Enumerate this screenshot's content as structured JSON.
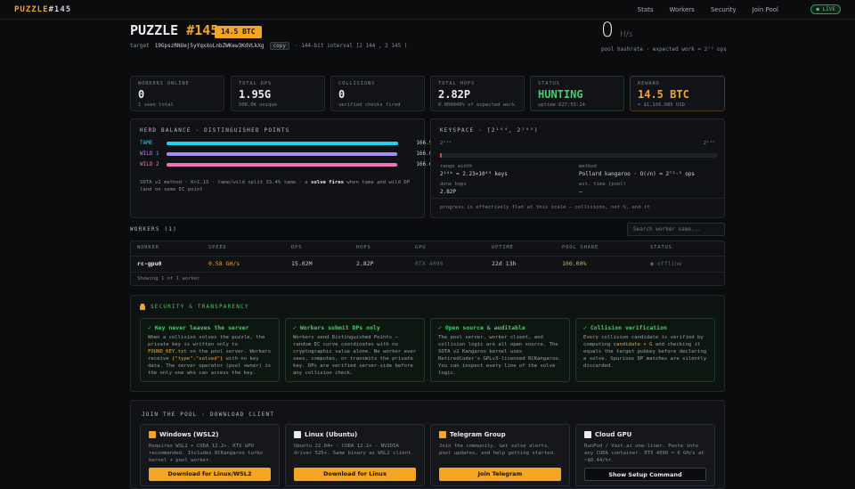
{
  "nav": {
    "brand_a": "PUZZLE",
    "brand_b": "#145",
    "links": [
      "Stats",
      "Workers",
      "Security",
      "Join Pool"
    ],
    "live": "● LIVE"
  },
  "header": {
    "title_a": "PUZZLE",
    "title_b": "#145",
    "badge": "14.5 BTC",
    "target_label": "target",
    "target_addr": "19GpszRNUej5yYqxXoLnbZWKew3KdVLkXg",
    "copy": "copy",
    "interval": "·  144-bit interval [2 144 , 2 145 )",
    "hashrate_value": "0",
    "hashrate_unit": "H/s",
    "hashrate_sub": "pool hashrate · expected work ≈ 2⁷² ops"
  },
  "stats": [
    {
      "label": "WORKERS ONLINE",
      "value": "0",
      "sub": "1 seen total",
      "color": "#e9ebee"
    },
    {
      "label": "TOTAL DPS",
      "value": "1.95G",
      "sub": "508.0K unique",
      "color": "#e9ebee"
    },
    {
      "label": "COLLISIONS",
      "value": "0",
      "sub": "verified checks fired",
      "color": "#e9ebee"
    },
    {
      "label": "TOTAL HOPS",
      "value": "2.82P",
      "sub": "0.000049% of expected work",
      "color": "#e9ebee"
    },
    {
      "label": "STATUS",
      "value": "HUNTING",
      "sub": "uptime 627:55:24",
      "color": "#3fd16b"
    },
    {
      "label": "REWARD",
      "value": "14.5 BTC",
      "sub": "≈ $1,156,085 USD",
      "color": "#f5a524"
    }
  ],
  "herd": {
    "title": "HERD BALANCE · DISTINGUISHED POINTS",
    "rows": [
      {
        "name": "TAME",
        "value": "166.9K",
        "fill": 1.0,
        "color": "#22d3ee"
      },
      {
        "name": "WILD 1",
        "value": "166.6K",
        "fill": 0.998,
        "color": "#a78bfa"
      },
      {
        "name": "WILD 2",
        "value": "166.6K",
        "fill": 0.998,
        "color": "#f472b6"
      }
    ],
    "note_a": "SOTA v2 method · K≈1.15 · tame/wild split 33.4% tame · a",
    "note_b": "solve fires",
    "note_c": "when tame and wild DP land on same EC point"
  },
  "keyspace": {
    "title": "KEYSPACE · [2¹⁴⁴, 2¹⁴⁵)",
    "lo": "2¹⁴⁴",
    "hi": "2¹⁴⁵",
    "progress": 0.0,
    "range_label": "range width",
    "range_value": "2¹⁴⁴ ≈ 2.23×10⁴³ keys",
    "method_label": "method",
    "method_value": "Pollard kangaroo · O(√n) ≈ 2⁷²·⁵ ops",
    "hops_label": "done hops",
    "hops_value": "2.82P",
    "est_label": "est. time (pool)",
    "est_value": "—",
    "note": "progress is effectively flat at this scale — collisions, not %, end it"
  },
  "workers": {
    "title": "WORKERS (1)",
    "search_placeholder": "Search worker name...",
    "columns": [
      "WORKER",
      "SPEED",
      "DPS",
      "HOPS",
      "GPU",
      "UPTIME",
      "POOL SHARE",
      "STATUS"
    ],
    "rows": [
      {
        "worker": "rc-gpu0",
        "speed": "0.58 GH/s",
        "dps": "15.02M",
        "hops": "2.82P",
        "gpu": "RTX 4090",
        "uptime": "22d 13h",
        "share": "100.00%",
        "status": "● offline"
      }
    ],
    "footer": "Showing 1 of 1 worker"
  },
  "security": {
    "title": "SECURITY & TRANSPARENCY",
    "cards": [
      {
        "head": "✓ Key never leaves the server",
        "body": "When a collision solves the puzzle, the private key is written only to <b>FOUND_KEY.txt</b> on the pool server. Workers receive <b>{\"type\":\"solved\"}</b> with no key data. The server operator (pool owner) is the only one who can access the key."
      },
      {
        "head": "✓ Workers submit DPs only",
        "body": "Workers send Distinguished Points — random EC curve coordinates with no cryptographic value alone. No worker ever sees, computes, or transmits the private key. DPs are verified server-side before any collision check."
      },
      {
        "head": "✓ Open source & auditable",
        "body": "The pool server, worker client, and collision logic are all open source. The SOTA v2 Kangaroo kernel uses RetiredCoder's GPLv3-licensed RCKangaroo. You can inspect every line of the solve logic."
      },
      {
        "head": "✓ Collision verification",
        "body": "Every collision candidate is verified by computing <b>candidate × G</b> and checking it equals the target pubkey before declaring a solve. Spurious DP matches are silently discarded."
      }
    ]
  },
  "join": {
    "title": "JOIN THE POOL · DOWNLOAD CLIENT",
    "cards": [
      {
        "icon": "windows-icon",
        "icon_color": "#f5a524",
        "head": "Windows (WSL2)",
        "body": "Requires WSL2 + CUDA 12.2+. RTX GPU recommended. Includes RCKangaroo turbo kernel + pool worker.",
        "button": "Download for Linux/WSL2",
        "dark": false
      },
      {
        "icon": "linux-icon",
        "icon_color": "#e9ebee",
        "head": "Linux (Ubuntu)",
        "body": "Ubuntu 22.04+ · CUDA 12.2+ · NVIDIA driver 525+. Same binary as WSL2 client.",
        "button": "Download for Linux",
        "dark": false
      },
      {
        "icon": "telegram-icon",
        "icon_color": "#f5a524",
        "head": "Telegram Group",
        "body": "Join the community. Get solve alerts, pool updates, and help getting started.",
        "button": "Join Telegram",
        "dark": false
      },
      {
        "icon": "cloud-icon",
        "icon_color": "#e9ebee",
        "head": "Cloud GPU",
        "body": "RunPod / Vast.ai one-liner. Paste into any CUDA container. RTX 4090 ≈ 6 GH/s at ~$0.44/hr.",
        "button": "Show Setup Command",
        "dark": true
      }
    ]
  }
}
